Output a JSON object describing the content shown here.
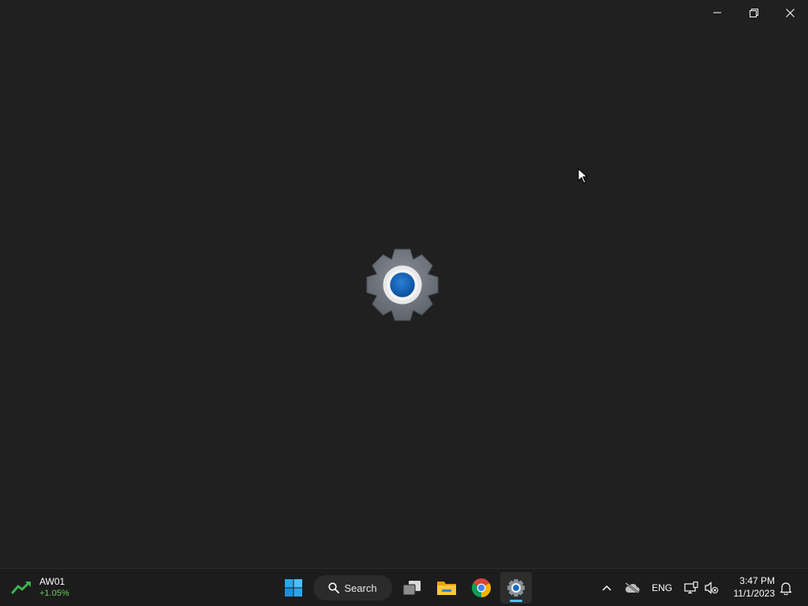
{
  "window": {
    "caption": {
      "minimize_icon": "minimize-icon",
      "restore_icon": "restore-icon",
      "close_icon": "close-icon"
    },
    "splash_icon": "settings-gear-icon",
    "accent_color": "#0f6cbd"
  },
  "taskbar": {
    "widget": {
      "icon": "stock-up-icon",
      "ticker": "AW01",
      "change": "+1.05%",
      "change_color": "#6ccb5f"
    },
    "search": {
      "icon": "search-icon",
      "label": "Search"
    },
    "apps": [
      {
        "name": "start",
        "icon": "windows-start-icon",
        "active": false
      },
      {
        "name": "task-view",
        "icon": "task-view-icon",
        "active": false
      },
      {
        "name": "file-explorer",
        "icon": "folder-icon",
        "active": false
      },
      {
        "name": "chrome",
        "icon": "chrome-icon",
        "active": false
      },
      {
        "name": "settings",
        "icon": "settings-gear-icon",
        "active": true
      }
    ],
    "tray": {
      "overflow_icon": "chevron-up-icon",
      "onedrive_icon": "cloud-offline-icon",
      "language": "ENG",
      "network_icon": "network-icon",
      "volume_icon": "volume-muted-icon",
      "time": "3:47 PM",
      "date": "11/1/2023",
      "notification_icon": "bell-icon"
    }
  }
}
